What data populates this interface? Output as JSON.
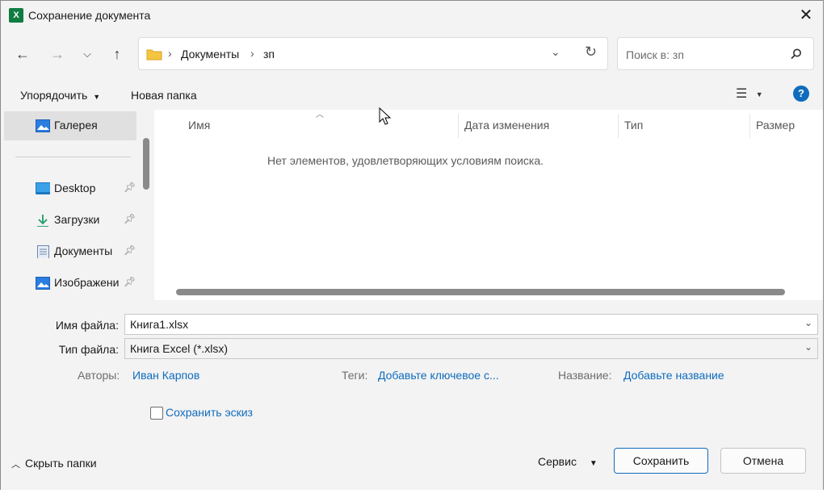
{
  "window": {
    "title": "Сохранение документа",
    "app_icon": "excel-icon",
    "close_icon": "close-icon"
  },
  "nav": {
    "back_icon": "arrow-left-icon",
    "forward_icon": "arrow-right-icon",
    "recent_icon": "chevron-down-icon",
    "up_icon": "arrow-up-icon"
  },
  "address": {
    "segments": [
      "Документы",
      "зп"
    ],
    "separator": "›"
  },
  "search": {
    "placeholder": "Поиск в: зп"
  },
  "toolbar": {
    "organize_label": "Упорядочить",
    "new_folder_label": "Новая папка",
    "help_label": "?"
  },
  "sidebar": {
    "items": [
      {
        "label": "Галерея",
        "icon": "gallery-icon",
        "pinned": false,
        "selected": true
      },
      {
        "label": "Desktop",
        "icon": "desktop-icon",
        "pinned": true
      },
      {
        "label": "Загрузки",
        "icon": "download-icon",
        "pinned": true
      },
      {
        "label": "Документы",
        "icon": "documents-icon",
        "pinned": true
      },
      {
        "label": "Изображени",
        "icon": "pictures-icon",
        "pinned": true
      }
    ]
  },
  "filelist": {
    "columns": [
      "Имя",
      "Дата изменения",
      "Тип",
      "Размер"
    ],
    "empty_message": "Нет элементов, удовлетворяющих условиям поиска."
  },
  "form": {
    "filename_label": "Имя файла:",
    "filename_value": "Книга1.xlsx",
    "filetype_label": "Тип файла:",
    "filetype_value": "Книга Excel (*.xlsx)",
    "authors_label": "Авторы:",
    "authors_value": "Иван Карпов",
    "tags_label": "Теги:",
    "tags_value": "Добавьте ключевое с...",
    "title_label": "Название:",
    "title_value": "Добавьте название",
    "thumbnail_label": "Сохранить эскиз"
  },
  "footer": {
    "hide_folders_label": "Скрыть папки",
    "tools_label": "Сервис",
    "save_label": "Сохранить",
    "cancel_label": "Отмена"
  },
  "colors": {
    "accent": "#0f6cbd",
    "excel_green": "#107c41"
  }
}
